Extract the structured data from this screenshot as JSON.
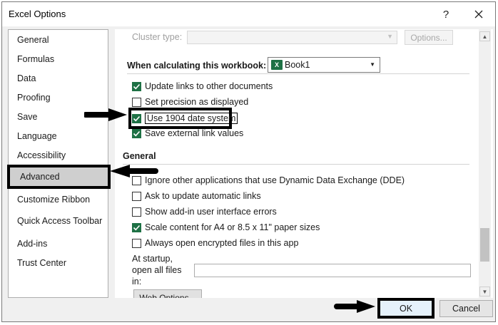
{
  "window": {
    "title": "Excel Options"
  },
  "titlebar": {
    "help_label": "?"
  },
  "sidebar": {
    "items": [
      {
        "label": "General"
      },
      {
        "label": "Formulas"
      },
      {
        "label": "Data"
      },
      {
        "label": "Proofing"
      },
      {
        "label": "Save"
      },
      {
        "label": "Language"
      },
      {
        "label": "Accessibility"
      },
      {
        "label": "Advanced"
      },
      {
        "label": "Customize Ribbon"
      },
      {
        "label": "Quick Access Toolbar"
      },
      {
        "label": "Add-ins"
      },
      {
        "label": "Trust Center"
      }
    ],
    "selected": "Advanced"
  },
  "cluster": {
    "label": "Cluster type:",
    "options_button": "Options..."
  },
  "calc_section": {
    "heading": "When calculating this workbook:",
    "workbook": "Book1",
    "workbook_icon": "X",
    "options": [
      {
        "label": "Update links to other documents",
        "checked": true
      },
      {
        "label": "Set precision as displayed",
        "checked": false
      },
      {
        "label": "Use 1904 date system",
        "checked": true
      },
      {
        "label": "Save external link values",
        "checked": true
      }
    ]
  },
  "general_section": {
    "heading": "General",
    "options": [
      {
        "label": "Ignore other applications that use Dynamic Data Exchange (DDE)",
        "checked": false
      },
      {
        "label": "Ask to update automatic links",
        "checked": false
      },
      {
        "label": "Show add-in user interface errors",
        "checked": false
      },
      {
        "label": "Scale content for A4 or 8.5 x 11\" paper sizes",
        "checked": true
      },
      {
        "label": "Always open encrypted files in this app",
        "checked": false
      }
    ],
    "startup_label_1": "At startup,",
    "startup_label_2": "open all files",
    "startup_label_3": "in:",
    "startup_value": "",
    "web_options_button": "Web Options..."
  },
  "footer": {
    "ok_label": "OK",
    "cancel_label": "Cancel"
  },
  "colors": {
    "check": "#1e7145",
    "annotation": "#000000",
    "selected_nav": "#cfcfcf"
  },
  "icons": [
    "close-icon",
    "help-icon",
    "excel-workbook-icon",
    "checkmark-icon",
    "annotation-arrow-icon"
  ]
}
